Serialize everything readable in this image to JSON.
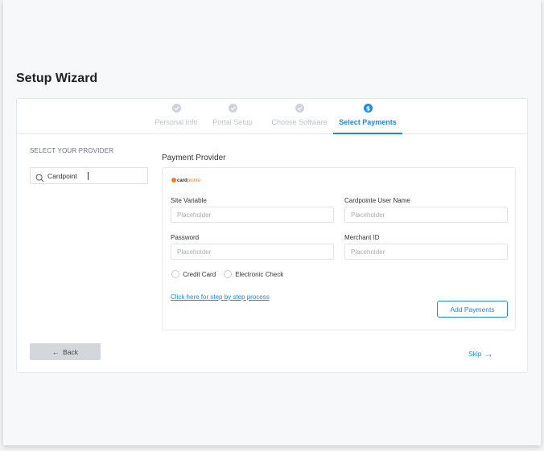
{
  "page": {
    "title": "Setup Wizard"
  },
  "stepper": {
    "steps": [
      {
        "label": "Personal Info",
        "state": "complete"
      },
      {
        "label": "Portal Setup",
        "state": "complete"
      },
      {
        "label": "Choose Software",
        "state": "complete"
      },
      {
        "label": "Select Payments",
        "state": "active"
      }
    ]
  },
  "provider_panel": {
    "heading": "SELECT YOUR PROVIDER",
    "search_value": "Cardpoint",
    "search_icon": "search-icon"
  },
  "payment": {
    "heading": "Payment Provider",
    "logo_text_1": "card",
    "logo_text_2": "pointe",
    "site_variable": {
      "label": "Site Variable",
      "placeholder": "Placeholder",
      "value": ""
    },
    "user_name": {
      "label": "Cardpointe User Name",
      "placeholder": "Placeholder",
      "value": ""
    },
    "password": {
      "label": "Password",
      "placeholder": "Placeholder",
      "value": ""
    },
    "merchant_id": {
      "label": "Merchant ID",
      "placeholder": "Placeholder",
      "value": ""
    },
    "options": [
      {
        "label": "Credit Card",
        "checked": false
      },
      {
        "label": "Electronic Check",
        "checked": false
      }
    ],
    "process_link": "Click here for step by step process",
    "add_button": "Add Payments"
  },
  "footer": {
    "back_label": "Back",
    "skip_label": "Skip"
  },
  "colors": {
    "accent": "#1e88e5",
    "logo_orange": "#f07c22",
    "step_complete": "#cfd3d8"
  }
}
